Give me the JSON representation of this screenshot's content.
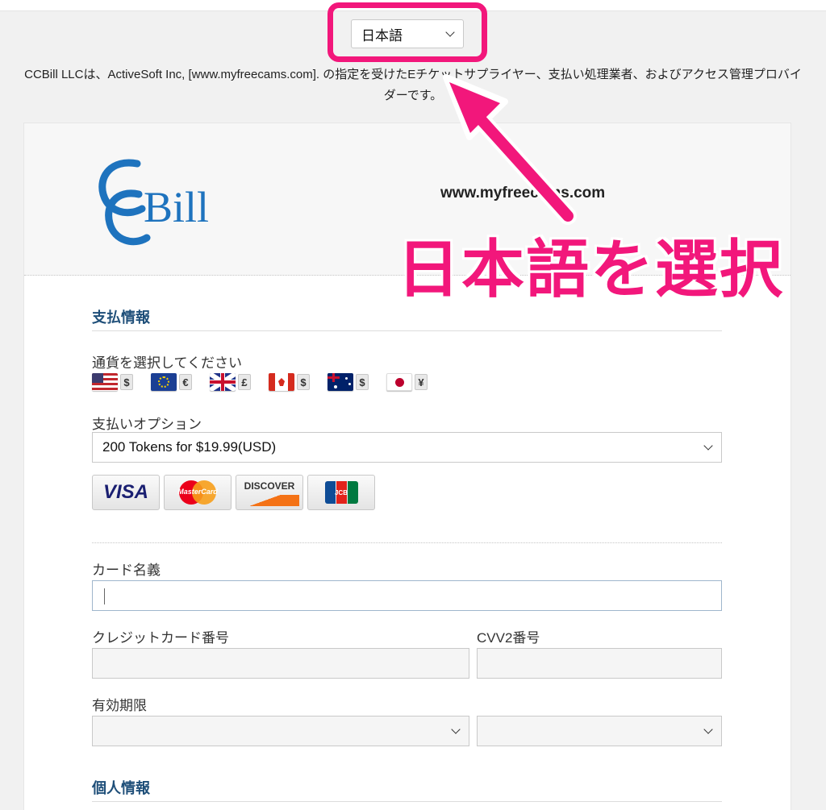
{
  "language_select": {
    "value": "日本語"
  },
  "notice": "CCBill LLCは、ActiveSoft Inc, [www.myfreecams.com]. の指定を受けたEチケットサプライヤー、支払い処理業者、およびアクセス管理プロバイダーです。",
  "header": {
    "logo_text": "CCBill",
    "merchant": "www.myfreecams.com"
  },
  "payment": {
    "section_title": "支払情報",
    "currency_label": "通貨を選択してください",
    "currencies": [
      {
        "flag": "us-flag-icon",
        "symbol": "$"
      },
      {
        "flag": "eu-flag-icon",
        "symbol": "€"
      },
      {
        "flag": "uk-flag-icon",
        "symbol": "£"
      },
      {
        "flag": "ca-flag-icon",
        "symbol": "$"
      },
      {
        "flag": "au-flag-icon",
        "symbol": "$"
      },
      {
        "flag": "jp-flag-icon",
        "symbol": "¥"
      }
    ],
    "option_label": "支払いオプション",
    "option_value": "200 Tokens for $19.99(USD)",
    "cards": [
      "VISA",
      "MasterCard",
      "DISCOVER",
      "JCB"
    ]
  },
  "card_form": {
    "name_label": "カード名義",
    "number_label": "クレジットカード番号",
    "cvv_label": "CVV2番号",
    "expiry_label": "有効期限"
  },
  "personal": {
    "section_title": "個人情報"
  },
  "annotation": {
    "text": "日本語を選択",
    "color": "#f2177b"
  },
  "colors": {
    "section_title": "#1f4f79",
    "accent": "#f2177b",
    "logo_blue": "#1e73be"
  }
}
